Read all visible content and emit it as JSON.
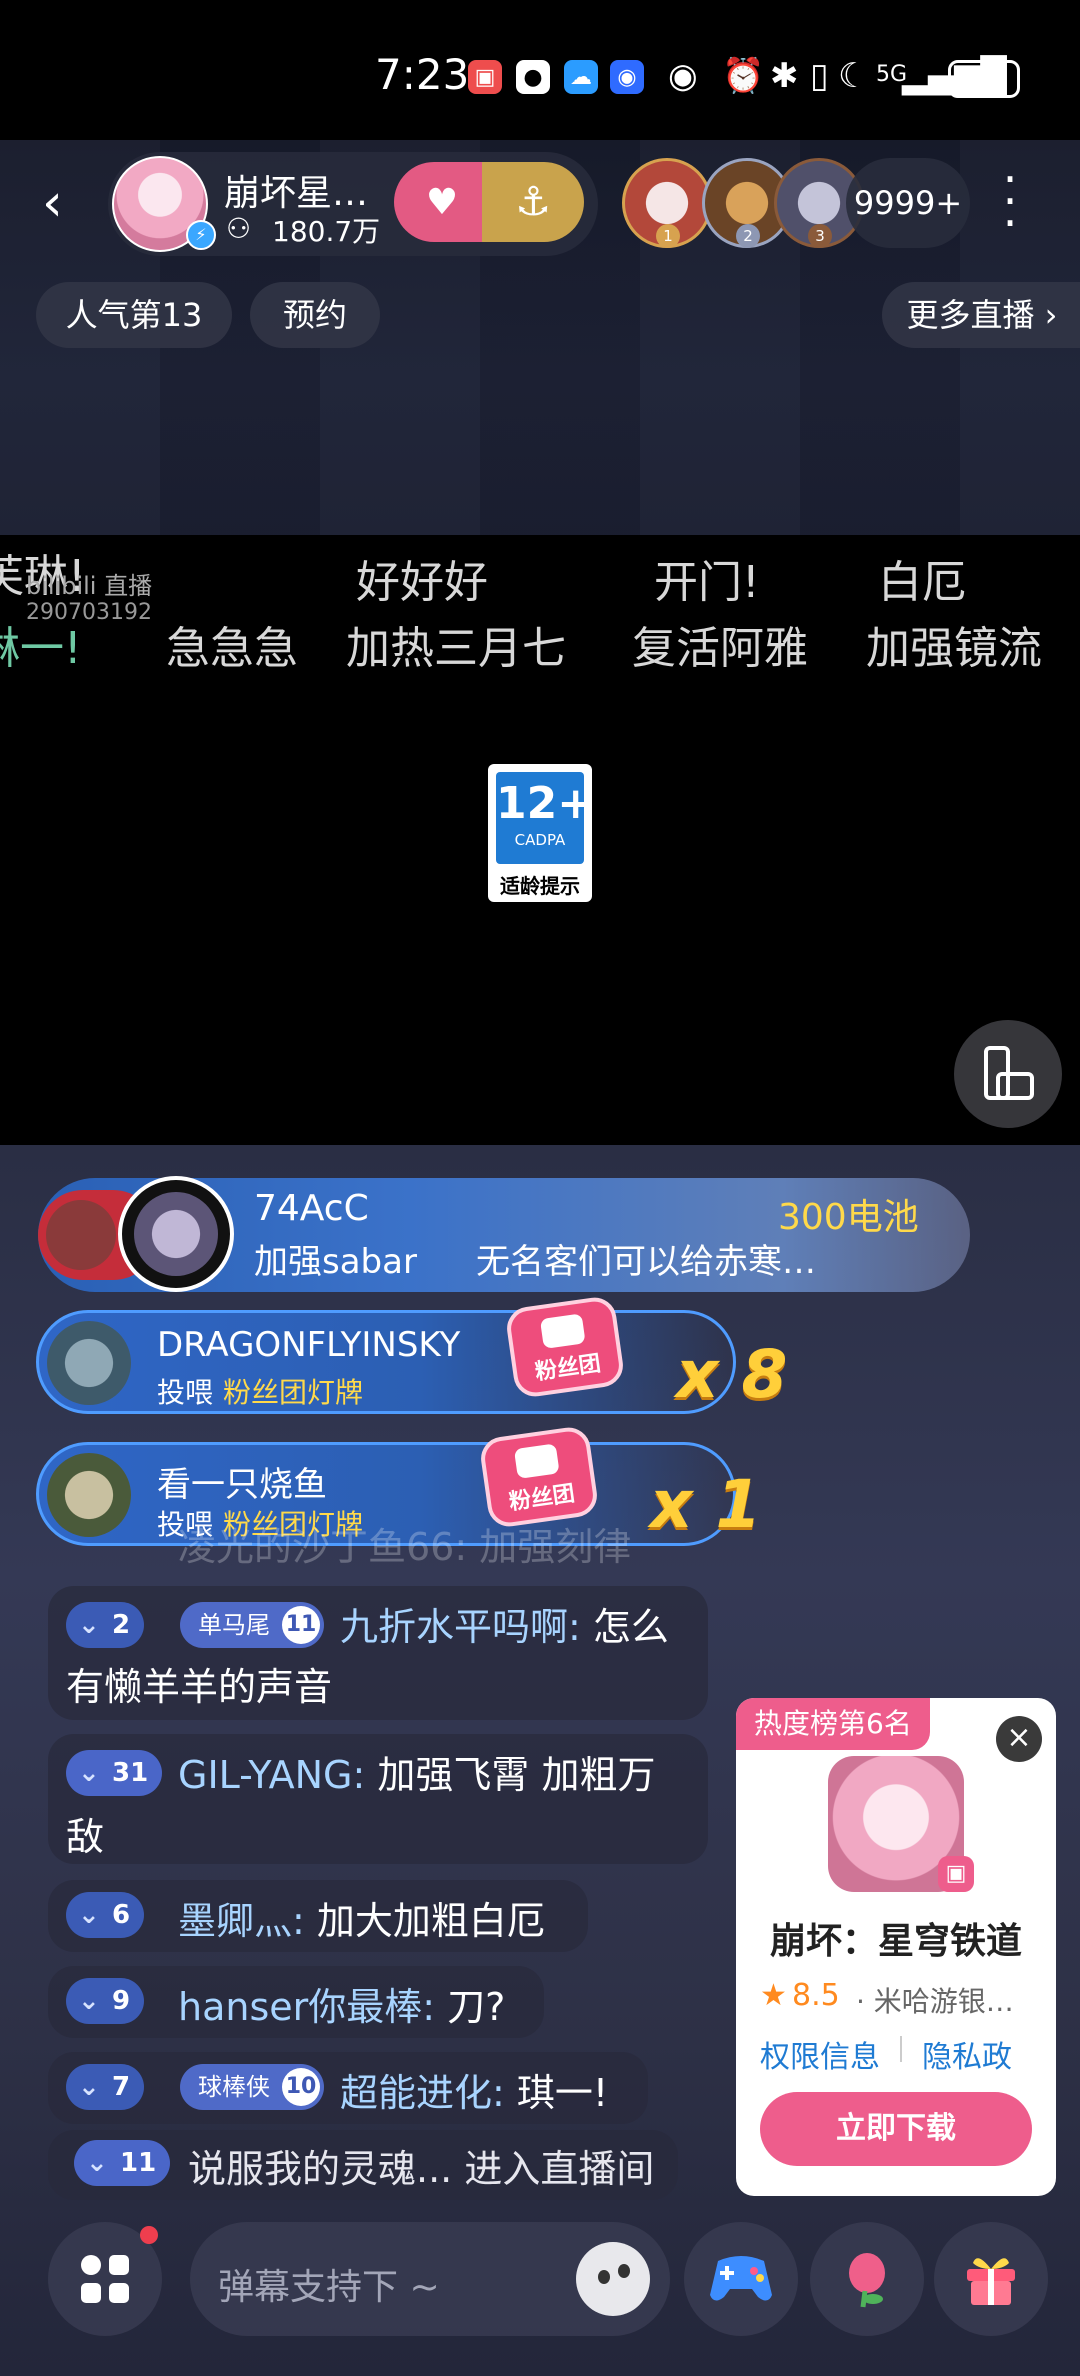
{
  "status_bar": {
    "time": "7:23",
    "network": "5G"
  },
  "header": {
    "anchor_name": "崩坏星…",
    "anchor_fans": "180.7万",
    "viewer_count": "9999+",
    "rank_badges": [
      "1",
      "2",
      "3"
    ],
    "chips": {
      "popularity": "人气第13",
      "reserve": "预约",
      "more_live": "更多直播 ›"
    }
  },
  "danmaku": [
    {
      "text": "芙琳!"
    },
    {
      "text": "好好好"
    },
    {
      "text": "开门!"
    },
    {
      "text": "白厄"
    },
    {
      "text": "琳一!"
    },
    {
      "text": "急急急"
    },
    {
      "text": "加热三月七"
    },
    {
      "text": "复活阿雅"
    },
    {
      "text": "加强镜流"
    }
  ],
  "watermark": {
    "brand": "bilibili 直播",
    "room": "290703192"
  },
  "age_rating": {
    "age": "12+",
    "org": "CADPA",
    "tip": "适龄提示"
  },
  "gift_banner": {
    "user": "74AcC",
    "amount": "300电池",
    "msg": "加强sabar",
    "sub": "无名客们可以给赤寒…"
  },
  "gift_rows": [
    {
      "user": "DRAGONFLYINSKY",
      "action": "投喂",
      "item": "粉丝团灯牌",
      "combo": "x 8",
      "icon_label": "粉丝团"
    },
    {
      "user": "看一只烧鱼",
      "action": "投喂",
      "item": "粉丝团灯牌",
      "combo": "x 1",
      "icon_label": "粉丝团"
    }
  ],
  "faded_msg": "凌光的沙丁鱼66: 加强刻律",
  "chat": [
    {
      "level": "2",
      "medal": "单马尾",
      "medal_level": "11",
      "user": "九折水平吗啊:",
      "text1": " 怎么",
      "text2": "有懒羊羊的声音"
    },
    {
      "level": "31",
      "user": "GIL-YANG:",
      "text1": " 加强飞霄 加粗万",
      "text2": "敌"
    },
    {
      "level": "6",
      "user": "墨卿灬:",
      "text1": " 加大加粗白厄"
    },
    {
      "level": "9",
      "user": "hanser你最棒:",
      "text1": " 刀?"
    },
    {
      "level": "7",
      "medal": "球棒侠",
      "medal_level": "10",
      "user": "超能进化:",
      "text1": " 琪一!"
    },
    {
      "level": "11",
      "user": "说服我的灵魂...",
      "text1": " 进入直播间"
    }
  ],
  "promo": {
    "tag": "热度榜第6名",
    "title": "崩坏：星穹铁道",
    "rating": "8.5",
    "developer": "· 米哈游银…",
    "link_permission": "权限信息",
    "link_privacy": "隐私政",
    "cta": "立即下载"
  },
  "input": {
    "placeholder": "弹幕支持下 ~"
  },
  "colors": {
    "accent_pink": "#ee5d8c",
    "gift_gold": "#ffd94a",
    "user_blue": "#a8d4ff"
  }
}
